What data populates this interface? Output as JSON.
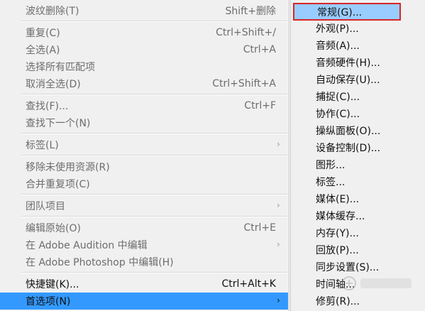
{
  "main_menu": {
    "items": [
      {
        "label": "波纹删除(T)",
        "shortcut": "Shift+删除",
        "enabled": false
      },
      {
        "label": "重复(C)",
        "shortcut": "Ctrl+Shift+/",
        "enabled": false
      },
      {
        "label": "全选(A)",
        "shortcut": "Ctrl+A",
        "enabled": false
      },
      {
        "label": "选择所有匹配项",
        "shortcut": "",
        "enabled": false
      },
      {
        "label": "取消全选(D)",
        "shortcut": "Ctrl+Shift+A",
        "enabled": false
      },
      {
        "label": "查找(F)...",
        "shortcut": "Ctrl+F",
        "enabled": false
      },
      {
        "label": "查找下一个(N)",
        "shortcut": "",
        "enabled": false
      },
      {
        "label": "标签(L)",
        "shortcut": "",
        "enabled": false
      },
      {
        "label": "移除未使用资源(R)",
        "shortcut": "",
        "enabled": false
      },
      {
        "label": "合并重复项(C)",
        "shortcut": "",
        "enabled": false
      },
      {
        "label": "团队项目",
        "shortcut": "",
        "enabled": false
      },
      {
        "label": "编辑原始(O)",
        "shortcut": "Ctrl+E",
        "enabled": false
      },
      {
        "label": "在 Adobe Audition 中编辑",
        "shortcut": "",
        "enabled": false
      },
      {
        "label": "在 Adobe Photoshop 中编辑(H)",
        "shortcut": "",
        "enabled": false
      },
      {
        "label": "快捷键(K)...",
        "shortcut": "Ctrl+Alt+K",
        "enabled": true
      },
      {
        "label": "首选项(N)",
        "shortcut": "",
        "enabled": true
      }
    ]
  },
  "sub_menu": {
    "items": [
      "常规(G)...",
      "外观(P)...",
      "音频(A)...",
      "音频硬件(H)...",
      "自动保存(U)...",
      "捕捉(C)...",
      "协作(C)...",
      "操纵面板(O)...",
      "设备控制(D)...",
      "图形...",
      "标签...",
      "媒体(E)...",
      "媒体缓存...",
      "内存(Y)...",
      "回放(P)...",
      "同步设置(S)...",
      "时间轴...",
      "修剪(R)..."
    ]
  },
  "icons": {
    "submenu_arrow": "chevron-right-icon"
  },
  "colors": {
    "selected_bg": "#3399ff",
    "highlight_bg": "#99ccff",
    "highlight_border": "#d9252a",
    "menu_bg": "#f0f0f0"
  }
}
